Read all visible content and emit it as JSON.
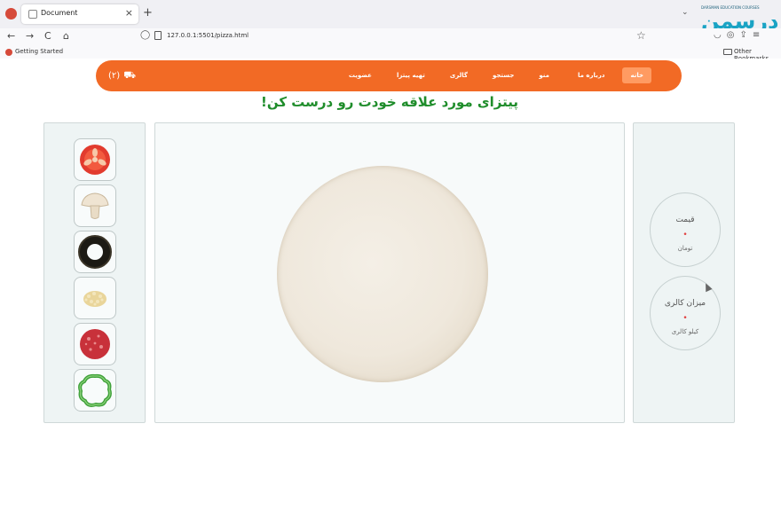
{
  "browser": {
    "tab_title": "Document",
    "tab_close": "×",
    "new_tab": "+",
    "tab_list": "⌄",
    "url": "127.0.0.1:5501/pizza.html",
    "back": "←",
    "forward": "→",
    "reload": "C",
    "home": "⌂",
    "star": "☆",
    "bookmark": "Getting Started",
    "other_bookmarks": "Other Bookmarks",
    "right_icons": "◡◎⇪≡"
  },
  "watermark": {
    "small": "DARSMAN EDUCATION COURSES",
    "logo": "درسمن"
  },
  "nav": {
    "cart_label": "(۲)",
    "cart_icon": "⛟",
    "items": [
      "خانه",
      "درباره ما",
      "منو",
      "جستجو",
      "گالری",
      "تهیه پیتزا",
      "عضویت"
    ],
    "active_index": 0
  },
  "headline": "پیتزای مورد علاقه خودت رو درست کن!",
  "ingredients": [
    "tomato",
    "mushroom",
    "olive",
    "cheese",
    "pepperoni",
    "green-pepper"
  ],
  "price": {
    "title": "قیمت",
    "value": "•",
    "unit": "تومان"
  },
  "calories": {
    "title": "میزان کالری",
    "value": "•",
    "unit": "کیلو کالری"
  },
  "colors": {
    "accent": "#f26a25",
    "headline": "#1f8d2b",
    "value": "#e04040"
  }
}
